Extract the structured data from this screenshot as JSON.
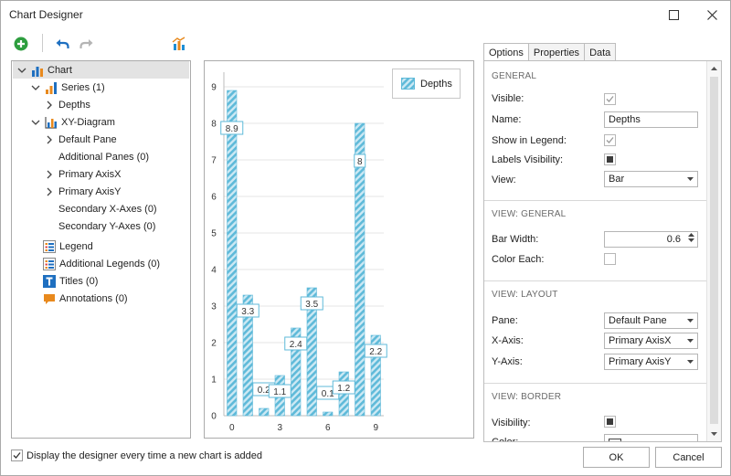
{
  "window": {
    "title": "Chart Designer"
  },
  "icons": {
    "minimize": "maximize-icon",
    "close": "close-icon",
    "add": "add-circle-icon",
    "undo": "undo-icon",
    "redo": "redo-icon",
    "wizard": "chart-wizard-icon"
  },
  "colors": {
    "accent": "#1e8fd6",
    "bar": "#5fbad9",
    "bar_fill": "#cde9f4",
    "selection": "#e3e3e3"
  },
  "tree": [
    {
      "label": "Chart"
    },
    {
      "label": "Series (1)"
    },
    {
      "label": "Depths"
    },
    {
      "label": "XY-Diagram"
    },
    {
      "label": "Default Pane"
    },
    {
      "label": "Additional Panes (0)"
    },
    {
      "label": "Primary AxisX"
    },
    {
      "label": "Primary AxisY"
    },
    {
      "label": "Secondary X-Axes (0)"
    },
    {
      "label": "Secondary Y-Axes (0)"
    },
    {
      "label": "Legend"
    },
    {
      "label": "Additional Legends (0)"
    },
    {
      "label": "Titles (0)"
    },
    {
      "label": "Annotations (0)"
    }
  ],
  "legend": {
    "series_name": "Depths"
  },
  "chart_data": {
    "type": "bar",
    "series": [
      {
        "name": "Depths",
        "x": [
          0,
          1,
          2,
          3,
          4,
          5,
          6,
          7,
          8,
          9
        ],
        "values": [
          8.9,
          3.3,
          0.2,
          1.1,
          2.4,
          3.5,
          0.1,
          1.2,
          8,
          2.2
        ],
        "labels": [
          "8.9",
          "3.3",
          "0.2",
          "1.1",
          "2.4",
          "3.5",
          "0.1",
          "1.2",
          "8",
          "2.2"
        ]
      }
    ],
    "xticks": [
      "0",
      "3",
      "6",
      "9"
    ],
    "xtick_values": [
      0,
      3,
      6,
      9
    ],
    "yticks": [
      "0",
      "1",
      "2",
      "3",
      "4",
      "5",
      "6",
      "7",
      "8",
      "9"
    ],
    "xlim": [
      -0.5,
      9.5
    ],
    "ylim": [
      0,
      9.4
    ],
    "grid": "horizontal",
    "legend_position": "top-right",
    "title": "",
    "xlabel": "",
    "ylabel": ""
  },
  "tabs": [
    "Options",
    "Properties",
    "Data"
  ],
  "props": {
    "general": "GENERAL",
    "visible": "Visible:",
    "name": "Name:",
    "name_value": "Depths",
    "show_in_legend": "Show in Legend:",
    "labels_visibility": "Labels Visibility:",
    "view": "View:",
    "view_value": "Bar",
    "view_general": "VIEW: GENERAL",
    "bar_width": "Bar Width:",
    "bar_width_value": "0.6",
    "color_each": "Color Each:",
    "view_layout": "VIEW: LAYOUT",
    "pane": "Pane:",
    "pane_value": "Default Pane",
    "x_axis": "X-Axis:",
    "x_axis_value": "Primary AxisX",
    "y_axis": "Y-Axis:",
    "y_axis_value": "Primary AxisY",
    "view_border": "VIEW: BORDER",
    "border_visibility": "Visibility:",
    "border_color": "Color:"
  },
  "footer": {
    "display_designer": "Display the designer every time a new chart is added",
    "ok": "OK",
    "cancel": "Cancel"
  }
}
